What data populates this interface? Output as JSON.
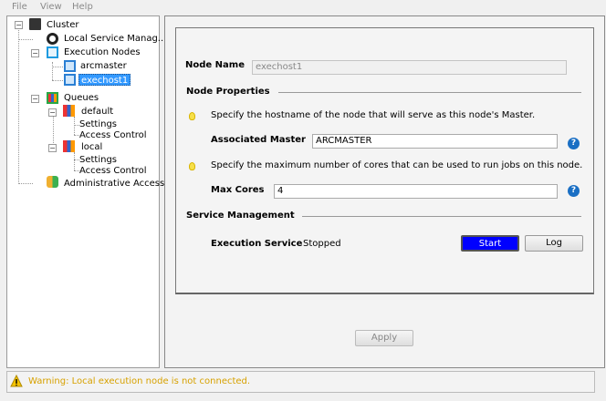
{
  "menu": {
    "file": "File",
    "view": "View",
    "help": "Help"
  },
  "tree": {
    "cluster": "Cluster",
    "local_service": "Local Service Manag...",
    "execution_nodes": "Execution Nodes",
    "arcmaster": "arcmaster",
    "exechost1": "exechost1",
    "queues": "Queues",
    "default": "default",
    "default_settings": "Settings",
    "default_access": "Access Control",
    "local": "local",
    "local_settings": "Settings",
    "local_access": "Access Control",
    "admin": "Administrative Access"
  },
  "form": {
    "node_name_label": "Node Name",
    "node_name_value": "exechost1",
    "node_properties": "Node Properties",
    "hint_master": "Specify the hostname of the node that will serve as this node's Master.",
    "assoc_master_label": "Associated Master",
    "assoc_master_value": "ARCMASTER",
    "hint_cores": "Specify the maximum number of cores that can be used to run jobs on this node.",
    "max_cores_label": "Max Cores",
    "max_cores_value": "4",
    "service_mgmt": "Service Management",
    "exec_service_label": "Execution Service",
    "exec_service_status": "Stopped",
    "start": "Start",
    "log": "Log",
    "help": "?",
    "apply": "Apply"
  },
  "status": {
    "warning": "Warning: Local execution node is not connected."
  },
  "colors": {
    "selection": "#3399ff",
    "start_button": "#0000ff",
    "warning_text": "#d7a100"
  }
}
